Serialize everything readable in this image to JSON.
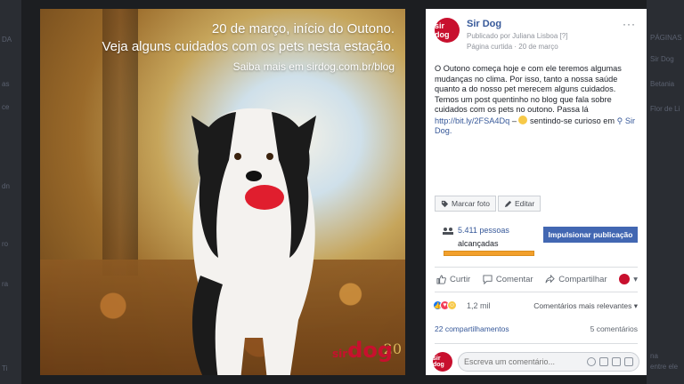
{
  "background": {
    "left_fragments": [
      "DA",
      "as",
      "ce",
      "dn",
      "ro",
      "ra",
      "Ti"
    ],
    "right_fragments": [
      "PÁGINAS",
      "Sir Dog",
      "Betania",
      "Flor de Li",
      "na",
      "entre ele"
    ]
  },
  "photo": {
    "line1": "20 de março, início do Outono.",
    "line2": "Veja alguns cuidados com os pets nesta estação.",
    "line3": "Saiba mais em sirdog.com.br/blog",
    "logo_prefix": "sir",
    "logo_word": "dog",
    "anniversary": "20"
  },
  "post": {
    "avatar_text": "sir dog",
    "page_name": "Sir Dog",
    "published_by": "Publicado por Juliana Lisboa [?]",
    "liked_page": "Página curtida",
    "date": "20 de março",
    "more": "···",
    "text_main": "O Outono começa hoje e com ele teremos algumas mudanças no clima. Por isso, tanto a nossa saúde quanto a do nosso pet merecem alguns cuidados. Temos um post quentinho no blog que fala sobre cuidados com os pets no outono. Passa lá",
    "link": "http://bit.ly/2FSA4Dq",
    "separator": " – ",
    "feeling": " sentindo-se curioso em",
    "location": "Sir Dog.",
    "tag_photo": "Marcar foto",
    "edit": "Editar",
    "reach_number": "5.411 pessoas",
    "reach_label": "alcançadas",
    "reach_fraction": 0.7,
    "boost": "Impulsionar publicação",
    "like": "Curtir",
    "comment": "Comentar",
    "share": "Compartilhar",
    "reactions_count": "1,2 mil",
    "relevant": "Comentários mais relevantes ▾",
    "shares_count": "22 compartilhamentos",
    "comments_count": "5 comentários",
    "comment_placeholder": "Escreva um comentário..."
  },
  "colors": {
    "brand": "#c8102e",
    "link": "#365899",
    "boost": "#4267b2",
    "reach_bar": "#f2a02b"
  }
}
